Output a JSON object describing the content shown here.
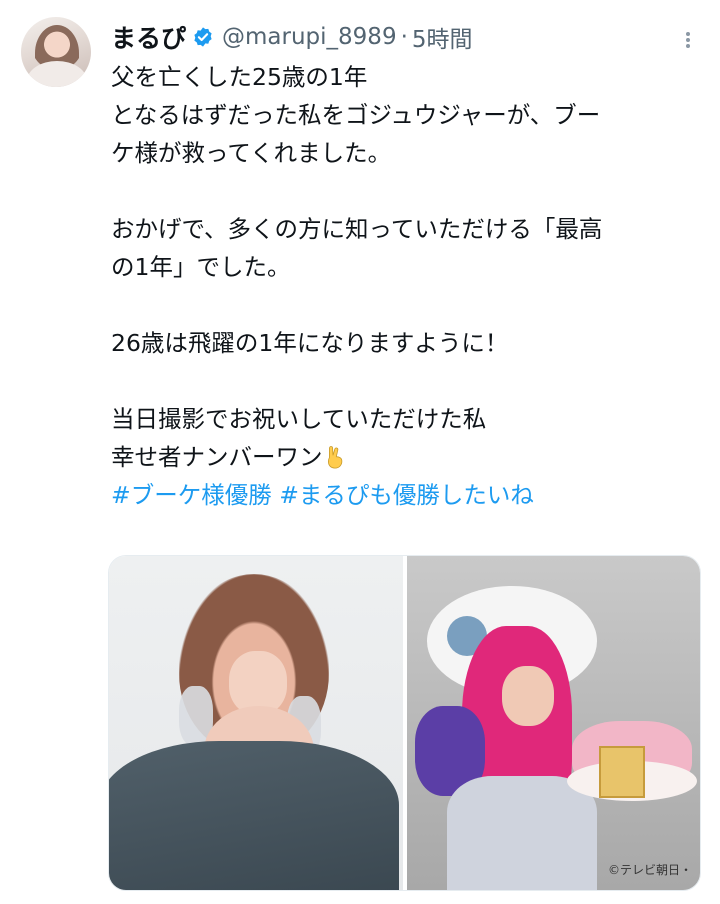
{
  "tweet": {
    "display_name": "まるぴ",
    "handle": "@marupi_8989",
    "separator": "·",
    "time": "5時間",
    "verified_color": "#1d9bf0",
    "lines": [
      "父を亡くした25歳の1年",
      "となるはずだった私をゴジュウジャーが、ブー",
      "ケ様が救ってくれました。",
      "",
      "おかげで、多くの方に知っていただける「最高",
      "の1年」でした。",
      "",
      "26歳は飛躍の1年になりますように！",
      "",
      "当日撮影でお祝いしていただけた私",
      "幸せ者ナンバーワン"
    ],
    "emoji": "victory-hand-icon",
    "hashtags": [
      "#ブーケ様優勝",
      "#まるぴも優勝したいね"
    ],
    "link_color": "#1d9bf0"
  },
  "media": {
    "photo_count": 2,
    "credit": "©テレビ朝日・"
  }
}
